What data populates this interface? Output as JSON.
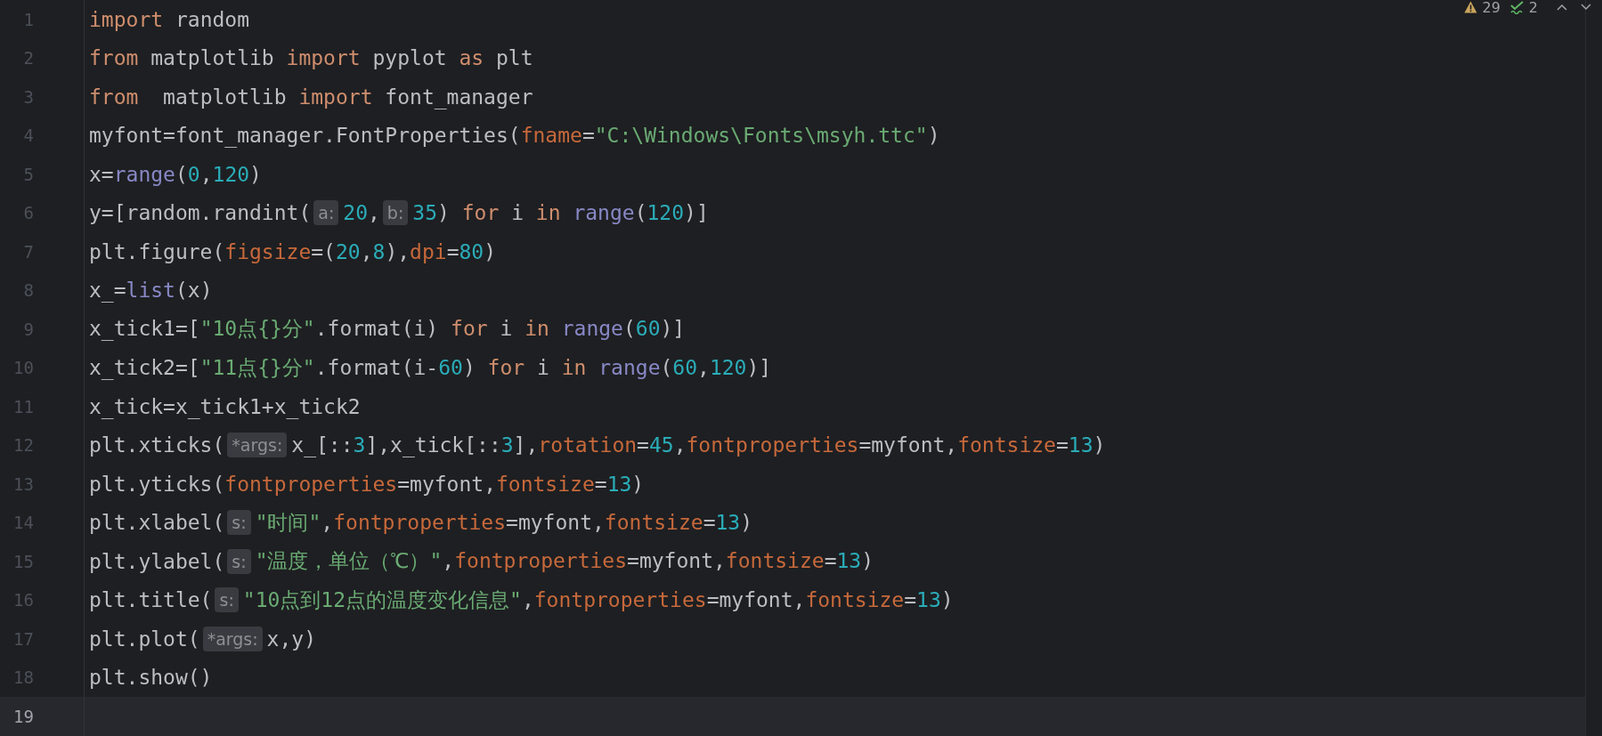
{
  "status": {
    "warnings": "29",
    "checks": "2"
  },
  "lines": [
    {
      "number": "1",
      "current": false,
      "segments": [
        {
          "kind": "code",
          "tokens": [
            {
              "kind": "keyword",
              "text": "import"
            },
            {
              "kind": "plain",
              "text": " random"
            }
          ]
        }
      ]
    },
    {
      "number": "2",
      "current": false,
      "segments": [
        {
          "kind": "code",
          "tokens": [
            {
              "kind": "keyword",
              "text": "from"
            },
            {
              "kind": "plain",
              "text": " matplotlib "
            },
            {
              "kind": "keyword",
              "text": "import"
            },
            {
              "kind": "plain",
              "text": " pyplot "
            },
            {
              "kind": "keyword",
              "text": "as"
            },
            {
              "kind": "plain",
              "text": " plt"
            }
          ]
        }
      ]
    },
    {
      "number": "3",
      "current": false,
      "segments": [
        {
          "kind": "code",
          "tokens": [
            {
              "kind": "keyword",
              "text": "from"
            },
            {
              "kind": "plain",
              "text": "  matplotlib "
            },
            {
              "kind": "keyword",
              "text": "import"
            },
            {
              "kind": "plain",
              "text": " font_manager"
            }
          ]
        }
      ]
    },
    {
      "number": "4",
      "current": false,
      "segments": [
        {
          "kind": "code",
          "tokens": [
            {
              "kind": "plain",
              "text": "myfont=font_manager.FontProperties("
            },
            {
              "kind": "param",
              "text": "fname"
            },
            {
              "kind": "plain",
              "text": "="
            },
            {
              "kind": "string",
              "text": "\"C:\\Windows\\Fonts\\msyh.ttc\""
            },
            {
              "kind": "plain",
              "text": ")"
            }
          ]
        }
      ]
    },
    {
      "number": "5",
      "current": false,
      "segments": [
        {
          "kind": "code",
          "tokens": [
            {
              "kind": "plain",
              "text": "x="
            },
            {
              "kind": "builtin",
              "text": "range"
            },
            {
              "kind": "plain",
              "text": "("
            },
            {
              "kind": "number",
              "text": "0"
            },
            {
              "kind": "plain",
              "text": ","
            },
            {
              "kind": "number",
              "text": "120"
            },
            {
              "kind": "plain",
              "text": ")"
            }
          ]
        }
      ]
    },
    {
      "number": "6",
      "current": false,
      "segments": [
        {
          "kind": "code",
          "tokens": [
            {
              "kind": "plain",
              "text": "y=[random.randint("
            }
          ]
        },
        {
          "kind": "hint",
          "text": "a:"
        },
        {
          "kind": "code",
          "tokens": [
            {
              "kind": "number",
              "text": "20"
            },
            {
              "kind": "plain",
              "text": ","
            }
          ]
        },
        {
          "kind": "hint",
          "text": "b:"
        },
        {
          "kind": "code",
          "tokens": [
            {
              "kind": "number",
              "text": "35"
            },
            {
              "kind": "plain",
              "text": ") "
            },
            {
              "kind": "keyword",
              "text": "for"
            },
            {
              "kind": "plain",
              "text": " i "
            },
            {
              "kind": "keyword",
              "text": "in"
            },
            {
              "kind": "builtin",
              "text": " range"
            },
            {
              "kind": "plain",
              "text": "("
            },
            {
              "kind": "number",
              "text": "120"
            },
            {
              "kind": "plain",
              "text": ")]"
            }
          ]
        }
      ]
    },
    {
      "number": "7",
      "current": false,
      "segments": [
        {
          "kind": "code",
          "tokens": [
            {
              "kind": "plain",
              "text": "plt.figure("
            },
            {
              "kind": "param",
              "text": "figsize"
            },
            {
              "kind": "plain",
              "text": "=("
            },
            {
              "kind": "number",
              "text": "20"
            },
            {
              "kind": "plain",
              "text": ","
            },
            {
              "kind": "number",
              "text": "8"
            },
            {
              "kind": "plain",
              "text": "),"
            },
            {
              "kind": "param",
              "text": "dpi"
            },
            {
              "kind": "plain",
              "text": "="
            },
            {
              "kind": "number",
              "text": "80"
            },
            {
              "kind": "plain",
              "text": ")"
            }
          ]
        }
      ]
    },
    {
      "number": "8",
      "current": false,
      "segments": [
        {
          "kind": "code",
          "tokens": [
            {
              "kind": "plain",
              "text": "x_="
            },
            {
              "kind": "builtin",
              "text": "list"
            },
            {
              "kind": "plain",
              "text": "(x)"
            }
          ]
        }
      ]
    },
    {
      "number": "9",
      "current": false,
      "segments": [
        {
          "kind": "code",
          "tokens": [
            {
              "kind": "plain",
              "text": "x_tick1=["
            },
            {
              "kind": "string",
              "text": "\"10点{}分\""
            },
            {
              "kind": "plain",
              "text": ".format(i) "
            },
            {
              "kind": "keyword",
              "text": "for"
            },
            {
              "kind": "plain",
              "text": " i "
            },
            {
              "kind": "keyword",
              "text": "in"
            },
            {
              "kind": "builtin",
              "text": " range"
            },
            {
              "kind": "plain",
              "text": "("
            },
            {
              "kind": "number",
              "text": "60"
            },
            {
              "kind": "plain",
              "text": ")]"
            }
          ]
        }
      ]
    },
    {
      "number": "10",
      "current": false,
      "segments": [
        {
          "kind": "code",
          "tokens": [
            {
              "kind": "plain",
              "text": "x_tick2=["
            },
            {
              "kind": "string",
              "text": "\"11点{}分\""
            },
            {
              "kind": "plain",
              "text": ".format(i-"
            },
            {
              "kind": "number",
              "text": "60"
            },
            {
              "kind": "plain",
              "text": ") "
            },
            {
              "kind": "keyword",
              "text": "for"
            },
            {
              "kind": "plain",
              "text": " i "
            },
            {
              "kind": "keyword",
              "text": "in"
            },
            {
              "kind": "builtin",
              "text": " range"
            },
            {
              "kind": "plain",
              "text": "("
            },
            {
              "kind": "number",
              "text": "60"
            },
            {
              "kind": "plain",
              "text": ","
            },
            {
              "kind": "number",
              "text": "120"
            },
            {
              "kind": "plain",
              "text": ")]"
            }
          ]
        }
      ]
    },
    {
      "number": "11",
      "current": false,
      "segments": [
        {
          "kind": "code",
          "tokens": [
            {
              "kind": "plain",
              "text": "x_tick=x_tick1+x_tick2"
            }
          ]
        }
      ]
    },
    {
      "number": "12",
      "current": false,
      "segments": [
        {
          "kind": "code",
          "tokens": [
            {
              "kind": "plain",
              "text": "plt.xticks("
            }
          ]
        },
        {
          "kind": "hint",
          "text": "*args:"
        },
        {
          "kind": "code",
          "tokens": [
            {
              "kind": "plain",
              "text": "x_[::"
            },
            {
              "kind": "number",
              "text": "3"
            },
            {
              "kind": "plain",
              "text": "],x_tick[::"
            },
            {
              "kind": "number",
              "text": "3"
            },
            {
              "kind": "plain",
              "text": "],"
            },
            {
              "kind": "param",
              "text": "rotation"
            },
            {
              "kind": "plain",
              "text": "="
            },
            {
              "kind": "number",
              "text": "45"
            },
            {
              "kind": "plain",
              "text": ","
            },
            {
              "kind": "param",
              "text": "fontproperties"
            },
            {
              "kind": "plain",
              "text": "=myfont,"
            },
            {
              "kind": "param",
              "text": "fontsize"
            },
            {
              "kind": "plain",
              "text": "="
            },
            {
              "kind": "number",
              "text": "13"
            },
            {
              "kind": "plain",
              "text": ")"
            }
          ]
        }
      ]
    },
    {
      "number": "13",
      "current": false,
      "segments": [
        {
          "kind": "code",
          "tokens": [
            {
              "kind": "plain",
              "text": "plt.yticks("
            },
            {
              "kind": "param",
              "text": "fontproperties"
            },
            {
              "kind": "plain",
              "text": "=myfont,"
            },
            {
              "kind": "param",
              "text": "fontsize"
            },
            {
              "kind": "plain",
              "text": "="
            },
            {
              "kind": "number",
              "text": "13"
            },
            {
              "kind": "plain",
              "text": ")"
            }
          ]
        }
      ]
    },
    {
      "number": "14",
      "current": false,
      "segments": [
        {
          "kind": "code",
          "tokens": [
            {
              "kind": "plain",
              "text": "plt.xlabel("
            }
          ]
        },
        {
          "kind": "hint",
          "text": "s:"
        },
        {
          "kind": "code",
          "tokens": [
            {
              "kind": "string",
              "text": "\"时间\""
            },
            {
              "kind": "plain",
              "text": ","
            },
            {
              "kind": "param",
              "text": "fontproperties"
            },
            {
              "kind": "plain",
              "text": "=myfont,"
            },
            {
              "kind": "param",
              "text": "fontsize"
            },
            {
              "kind": "plain",
              "text": "="
            },
            {
              "kind": "number",
              "text": "13"
            },
            {
              "kind": "plain",
              "text": ")"
            }
          ]
        }
      ]
    },
    {
      "number": "15",
      "current": false,
      "segments": [
        {
          "kind": "code",
          "tokens": [
            {
              "kind": "plain",
              "text": "plt.ylabel("
            }
          ]
        },
        {
          "kind": "hint",
          "text": "s:"
        },
        {
          "kind": "code",
          "tokens": [
            {
              "kind": "string",
              "text": "\"温度，单位（℃）\""
            },
            {
              "kind": "plain",
              "text": ","
            },
            {
              "kind": "param",
              "text": "fontproperties"
            },
            {
              "kind": "plain",
              "text": "=myfont,"
            },
            {
              "kind": "param",
              "text": "fontsize"
            },
            {
              "kind": "plain",
              "text": "="
            },
            {
              "kind": "number",
              "text": "13"
            },
            {
              "kind": "plain",
              "text": ")"
            }
          ]
        }
      ]
    },
    {
      "number": "16",
      "current": false,
      "segments": [
        {
          "kind": "code",
          "tokens": [
            {
              "kind": "plain",
              "text": "plt.title("
            }
          ]
        },
        {
          "kind": "hint",
          "text": "s:"
        },
        {
          "kind": "code",
          "tokens": [
            {
              "kind": "string",
              "text": "\"10点到12点的温度变化信息\""
            },
            {
              "kind": "plain",
              "text": ","
            },
            {
              "kind": "param",
              "text": "fontproperties"
            },
            {
              "kind": "plain",
              "text": "=myfont,"
            },
            {
              "kind": "param",
              "text": "fontsize"
            },
            {
              "kind": "plain",
              "text": "="
            },
            {
              "kind": "number",
              "text": "13"
            },
            {
              "kind": "plain",
              "text": ")"
            }
          ]
        }
      ]
    },
    {
      "number": "17",
      "current": false,
      "segments": [
        {
          "kind": "code",
          "tokens": [
            {
              "kind": "plain",
              "text": "plt.plot("
            }
          ]
        },
        {
          "kind": "hint",
          "text": "*args:"
        },
        {
          "kind": "code",
          "tokens": [
            {
              "kind": "plain",
              "text": "x,y)"
            }
          ]
        }
      ]
    },
    {
      "number": "18",
      "current": false,
      "segments": [
        {
          "kind": "code",
          "tokens": [
            {
              "kind": "plain",
              "text": "plt.show()"
            }
          ]
        }
      ]
    },
    {
      "number": "19",
      "current": true
    }
  ]
}
